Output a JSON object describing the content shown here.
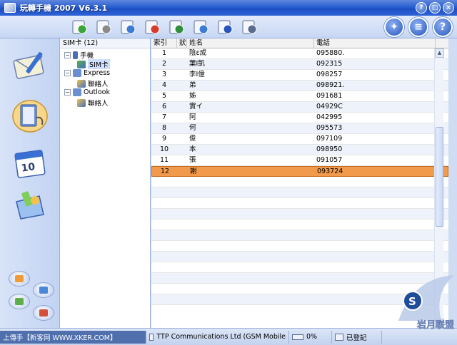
{
  "window": {
    "title": "玩轉手機 2007 V6.3.1",
    "controls": [
      "?",
      "□",
      "×"
    ]
  },
  "toolbar": {
    "tools": [
      {
        "name": "back-icon",
        "color": "#3aa33a"
      },
      {
        "name": "forward-icon",
        "color": "#8a8a8a"
      },
      {
        "name": "new-contact-icon",
        "color": "#3b7bd6"
      },
      {
        "name": "delete-icon",
        "color": "#d63b2b"
      },
      {
        "name": "sync-icon",
        "color": "#2f8f3f"
      },
      {
        "name": "group-icon",
        "color": "#3b7bd6"
      },
      {
        "name": "search-icon",
        "color": "#2a55b8"
      },
      {
        "name": "print-icon",
        "color": "#5a6b8c"
      }
    ],
    "right_buttons": [
      "✦",
      "≡",
      "?"
    ]
  },
  "tree": {
    "header": "SIM卡 (12)",
    "nodes": [
      {
        "label": "手機",
        "level": 0,
        "expander": "−"
      },
      {
        "label": "SIM卡",
        "level": 1,
        "selected": true
      },
      {
        "label": "Express",
        "level": 0,
        "expander": "−"
      },
      {
        "label": "聯絡人",
        "level": 1
      },
      {
        "label": "Outlook",
        "level": 0,
        "expander": "−"
      },
      {
        "label": "聯絡人",
        "level": 1
      }
    ]
  },
  "table": {
    "columns": [
      "索引",
      "狀態",
      "姓名",
      "電話"
    ],
    "rows": [
      {
        "index": "1",
        "status": "",
        "name": "陰ε成",
        "phone": "095880."
      },
      {
        "index": "2",
        "status": "",
        "name": "葉Ⅰ凱",
        "phone": "092315"
      },
      {
        "index": "3",
        "status": "",
        "name": "李Ⅰ億",
        "phone": "098257"
      },
      {
        "index": "4",
        "status": "",
        "name": "弟",
        "phone": "098921."
      },
      {
        "index": "5",
        "status": "",
        "name": "姊",
        "phone": "091681"
      },
      {
        "index": "6",
        "status": "",
        "name": "實イ",
        "phone": "04929C"
      },
      {
        "index": "7",
        "status": "",
        "name": "阿",
        "phone": "042995"
      },
      {
        "index": "8",
        "status": "",
        "name": "何",
        "phone": "095573"
      },
      {
        "index": "9",
        "status": "",
        "name": "俊",
        "phone": "097109"
      },
      {
        "index": "10",
        "status": "",
        "name": "本",
        "phone": "098950"
      },
      {
        "index": "11",
        "status": "",
        "name": "張",
        "phone": "091057"
      },
      {
        "index": "12",
        "status": "",
        "name": "謝",
        "phone": "093724",
        "selected": true
      }
    ]
  },
  "statusbar": {
    "left": "上傳手【新客网 WWW.XKER.COM】",
    "provider": "TTP Communications Ltd (GSM Mobile",
    "battery": "0%",
    "registered": "已登記"
  },
  "watermark": "岩月联盟"
}
